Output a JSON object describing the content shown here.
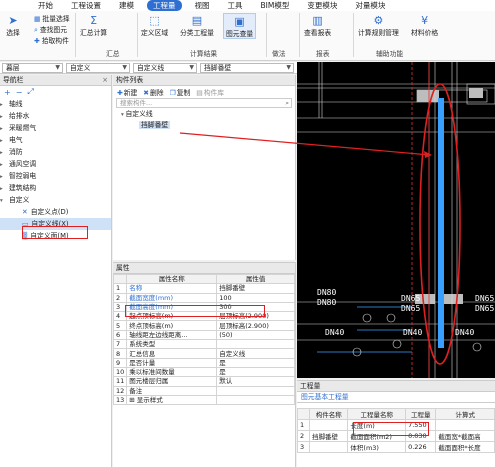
{
  "menu": [
    "开始",
    "工程设置",
    "建模",
    "工程量",
    "视图",
    "工具",
    "BIM模型",
    "变更模块",
    "对量模块"
  ],
  "menu_active_index": 3,
  "ribbon": {
    "select": "选择",
    "batch_select": "批量选择",
    "find_element": "查找图元",
    "pick_component": "拾取构件",
    "summary_calc": "汇总计算",
    "summary_group": "汇总",
    "define_region": "定义区域",
    "classify_qty": "分类工程量",
    "element_qty": "图元查量",
    "calc_result_group": "计算结果",
    "practice": "做法",
    "view_report": "查看报表",
    "report_group": "报表",
    "calc_manage": "计算规则管理",
    "material_price": "材料价格",
    "assist_group": "辅助功能"
  },
  "combos": [
    "暮层",
    "自定义",
    "自定义线",
    "挡脚番壁"
  ],
  "nav": {
    "title": "导航栏",
    "items": [
      "轴线",
      "给排水",
      "采暖燃气",
      "电气",
      "消防",
      "通风空调",
      "智控弱电",
      "建筑结构",
      "自定义"
    ],
    "subitems": [
      "自定义点(D)",
      "自定义线(X)",
      "自定义面(M)"
    ]
  },
  "complist": {
    "title": "构件列表",
    "new": "新建",
    "delete": "删除",
    "copy": "复制",
    "library": "构件库",
    "search_placeholder": "搜索构件...",
    "tree_parent": "自定义线",
    "tree_child": "挡脚番壁"
  },
  "props": {
    "title": "属性",
    "col_name": "属性名称",
    "col_value": "属性值",
    "rows": [
      {
        "n": "1",
        "name": "名称",
        "value": "挡脚番壁",
        "blue": true
      },
      {
        "n": "2",
        "name": "截面宽度(mm)",
        "value": "100",
        "blue": true
      },
      {
        "n": "3",
        "name": "截面高度(mm)",
        "value": "300",
        "blue": true
      },
      {
        "n": "4",
        "name": "起点顶标高(m)",
        "value": "层顶标高(2.900)",
        "blue": false
      },
      {
        "n": "5",
        "name": "终点顶标高(m)",
        "value": "层顶标高(2.900)",
        "blue": false
      },
      {
        "n": "6",
        "name": "轴线距左边线距离...",
        "value": "(50)",
        "blue": false
      },
      {
        "n": "7",
        "name": "系统类型",
        "value": "",
        "blue": false
      },
      {
        "n": "8",
        "name": "汇总信息",
        "value": "自定义线",
        "blue": false
      },
      {
        "n": "9",
        "name": "是否计量",
        "value": "是",
        "blue": false
      },
      {
        "n": "10",
        "name": "乘以标准间数量",
        "value": "是",
        "blue": false
      },
      {
        "n": "11",
        "name": "图元楼层归属",
        "value": "默认",
        "blue": false
      },
      {
        "n": "12",
        "name": "备注",
        "value": "",
        "blue": false
      },
      {
        "n": "13",
        "name": "⊞ 显示样式",
        "value": "",
        "blue": false
      }
    ]
  },
  "canvas": {
    "labels": [
      "DN80",
      "DN80",
      "DN65",
      "DN65",
      "DN65",
      "DN65",
      "DN40",
      "DN40",
      "DN40"
    ]
  },
  "qty": {
    "title": "工程量",
    "tab": "图元基本工程量",
    "headers": [
      "",
      "构件名称",
      "工程量名称",
      "工程量",
      "计算式"
    ],
    "rows": [
      {
        "n": "1",
        "comp": "",
        "name": "长度(m)",
        "value": "7.550",
        "formula": ""
      },
      {
        "n": "2",
        "comp": "挡脚番壁",
        "name": "截面面积(m2)",
        "value": "0.030",
        "formula": "截面宽*截面高"
      },
      {
        "n": "3",
        "comp": "",
        "name": "体积(m3)",
        "value": "0.226",
        "formula": "截面面积*长度"
      }
    ]
  },
  "colors": {
    "accent": "#2f6fd1",
    "highlight": "#e02020",
    "canvas_bg": "#000000",
    "pipe": "#3aa0ff"
  }
}
